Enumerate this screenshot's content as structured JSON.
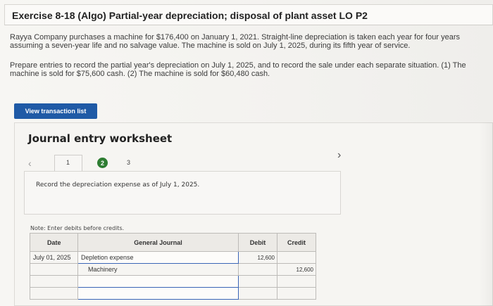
{
  "header": {
    "title": "Exercise 8-18 (Algo) Partial-year depreciation; disposal of plant asset LO P2"
  },
  "problem": {
    "paragraph1": "Rayya Company purchases a machine for $176,400 on January 1, 2021. Straight-line depreciation is taken each year for four years assuming a seven-year life and no salvage value. The machine is sold on July 1, 2025, during its fifth year of service.",
    "paragraph2": "Prepare entries to record the partial year's depreciation on July 1, 2025, and to record the sale under each separate situation. (1) The machine is sold for $75,600 cash. (2) The machine is sold for $60,480 cash."
  },
  "buttons": {
    "view_transaction_list": "View transaction list"
  },
  "worksheet": {
    "title": "Journal entry worksheet",
    "tabs": [
      "1",
      "2",
      "3"
    ],
    "instruction": "Record the depreciation expense as of July 1, 2025.",
    "note": "Note: Enter debits before credits."
  },
  "journal": {
    "headers": {
      "date": "Date",
      "general_journal": "General Journal",
      "debit": "Debit",
      "credit": "Credit"
    },
    "rows": [
      {
        "date": "July 01, 2025",
        "account": "Depletion expense",
        "debit": "12,600",
        "credit": ""
      },
      {
        "date": "",
        "account": "Machinery",
        "debit": "",
        "credit": "12,600"
      },
      {
        "date": "",
        "account": "",
        "debit": "",
        "credit": ""
      },
      {
        "date": "",
        "account": "",
        "debit": "",
        "credit": ""
      }
    ]
  },
  "icons": {
    "prev": "chevron-left-icon",
    "next": "chevron-right-icon"
  },
  "colors": {
    "primary_button": "#1f5aa6",
    "completed_tab": "#2e7d32"
  }
}
